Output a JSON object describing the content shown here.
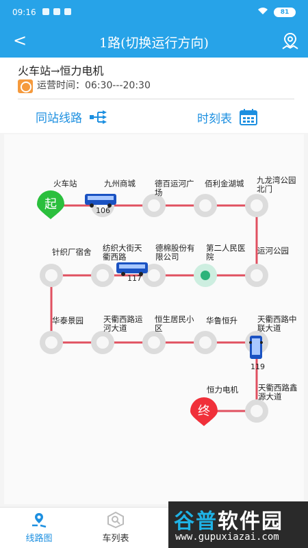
{
  "status": {
    "time": "09:16",
    "battery": "81"
  },
  "header": {
    "back": "<",
    "title": "1路(切换运行方向)"
  },
  "info": {
    "route": "火车站→恒力电机",
    "time_label": "运营时间：",
    "time_range": "06:30---20:30"
  },
  "actions": {
    "same_station": "同站线路",
    "timetable": "时刻表"
  },
  "markers": {
    "start": "起",
    "end": "终"
  },
  "stops": [
    "火车站",
    "九州商城",
    "德百运河广\n场",
    "佰利金湖城",
    "九龙湾公园\n北门",
    "运河公园",
    "第二人民医\n院",
    "德棉股份有\n限公司",
    "纺织大街天\n衢西路",
    "针织厂宿舍",
    "华泰景园",
    "天衢西路运\n河大道",
    "恒生居民小\n区",
    "华鲁恒升",
    "天衢西路中\n联大道",
    "天衢西路鑫\n源大道",
    "恒力电机"
  ],
  "buses": [
    "106",
    "117",
    "119"
  ],
  "tabs": {
    "route_map": "线路图",
    "bus_list": "车列表"
  },
  "watermark": {
    "brand_a": "谷普",
    "brand_b": "软件园",
    "url": "www.gupuxiazai.com"
  },
  "colors": {
    "accent": "#27a3e8",
    "route": "#e05060",
    "start": "#2bbf3d",
    "end": "#f0303a"
  }
}
